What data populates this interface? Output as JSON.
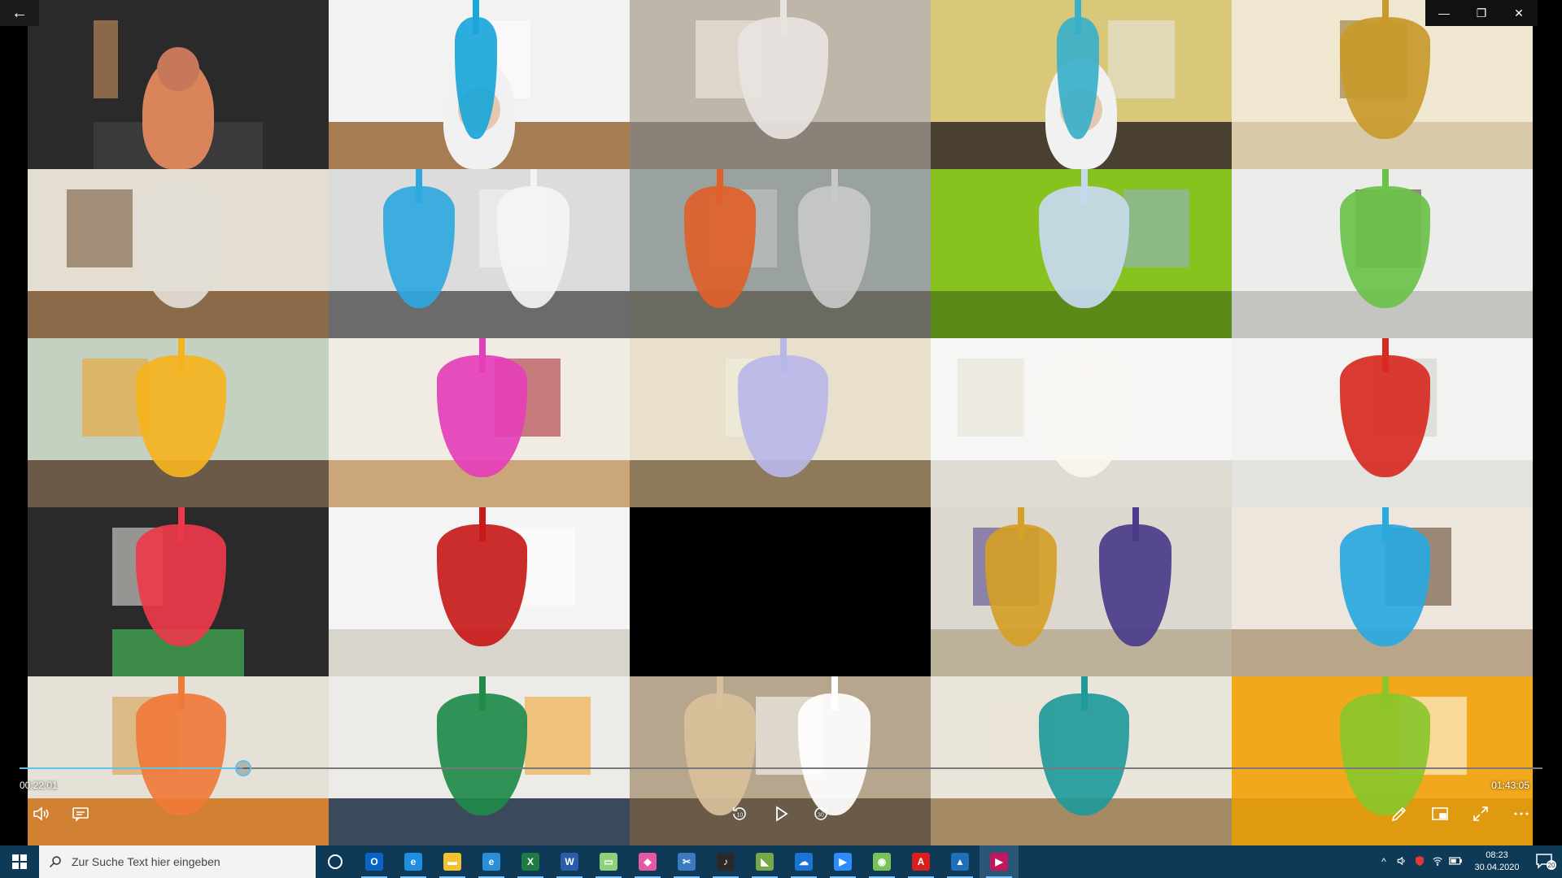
{
  "window": {
    "back_glyph": "←",
    "controls": {
      "minimize": "—",
      "maximize": "❐",
      "close": "✕"
    }
  },
  "player": {
    "current_time": "00:22:01",
    "total_time": "01:43:05",
    "progress_fraction": 0.147,
    "accent": "#5ec3ea",
    "buttons": {
      "volume": "volume-icon",
      "captions": "captions-icon",
      "rewind": "rewind-10-icon",
      "rewind_label": "10",
      "play": "play-icon",
      "forward": "forward-30-icon",
      "forward_label": "30",
      "edit": "pencil-icon",
      "miniview": "mini-view-icon",
      "fullscreen": "fullscreen-icon",
      "more": "more-icon"
    }
  },
  "tiles": [
    {
      "wall": "#2a2a2a",
      "floor": "#3a3a3a",
      "content": "person-outdoor",
      "silk": "",
      "accent": "#d99b63"
    },
    {
      "wall": "#f2f2f2",
      "floor": "#a67c52",
      "content": "person-indoor",
      "silk": "#1aa6d8",
      "accent": "#ffffff"
    },
    {
      "wall": "#bfb6aa",
      "floor": "#8a8278",
      "content": "silk",
      "silk": "#e8e4e0",
      "accent": "#f4f0e6"
    },
    {
      "wall": "#d9c77a",
      "floor": "#4a4030",
      "content": "person-indoor",
      "silk": "#39b0c9",
      "accent": "#e8e8e8"
    },
    {
      "wall": "#f0e7d0",
      "floor": "#d8c9a8",
      "content": "silk",
      "silk": "#c99a2b",
      "accent": "#8a6a20"
    },
    {
      "wall": "#e4ddd2",
      "floor": "#8b6a4a",
      "content": "silk",
      "silk": "#e2ddd5",
      "accent": "#6b4a2a"
    },
    {
      "wall": "#dcdcdc",
      "floor": "#6b6b6b",
      "content": "two-silks",
      "silk": "#2fa8e0",
      "accent": "#f4f4f4"
    },
    {
      "wall": "#9aa2a0",
      "floor": "#6a6a60",
      "content": "two-silks",
      "silk": "#e0602a",
      "accent": "#c8c8c8"
    },
    {
      "wall": "#88c21f",
      "floor": "#5b8a18",
      "content": "silk",
      "silk": "#c7d9f0",
      "accent": "#8fb3d9"
    },
    {
      "wall": "#ececea",
      "floor": "#c4c4c0",
      "content": "silk",
      "silk": "#6ac24a",
      "accent": "#4a3525"
    },
    {
      "wall": "#c4d1c0",
      "floor": "#6b5a48",
      "content": "silk",
      "silk": "#f5b31f",
      "accent": "#f0a020"
    },
    {
      "wall": "#f0ebe3",
      "floor": "#caa678",
      "content": "silk",
      "silk": "#e43fb8",
      "accent": "#a51f2a"
    },
    {
      "wall": "#e8e0cc",
      "floor": "#8c7a5a",
      "content": "silk",
      "silk": "#b9b6e8",
      "accent": "#f3f0e0"
    },
    {
      "wall": "#f6f6f4",
      "floor": "#dedbd3",
      "content": "silk",
      "silk": "#f8f6f0",
      "accent": "#e6e0d2"
    },
    {
      "wall": "#f2f2f0",
      "floor": "#e2e2de",
      "content": "silk",
      "silk": "#d72b22",
      "accent": "#d0d0cc"
    },
    {
      "wall": "#2a2a2a",
      "floor": "#3b8a48",
      "content": "silk-narrow",
      "silk": "#ec3a4a",
      "accent": "#f0ede6"
    },
    {
      "wall": "#f4f4f4",
      "floor": "#d8d5cc",
      "content": "silk",
      "silk": "#c71a1a",
      "accent": "#ffffff"
    },
    {
      "wall": "#000000",
      "floor": "#000000",
      "content": "empty",
      "silk": "",
      "accent": "#000000"
    },
    {
      "wall": "#dcd8cf",
      "floor": "#bcb29a",
      "content": "two-silks",
      "silk": "#d4a028",
      "accent": "#4a3c8a"
    },
    {
      "wall": "#ece6dc",
      "floor": "#b9a58a",
      "content": "silk",
      "silk": "#2aa8e0",
      "accent": "#5a3b22"
    },
    {
      "wall": "#e6e1d6",
      "floor": "#d08030",
      "content": "silk",
      "silk": "#f07a3a",
      "accent": "#d39a48"
    },
    {
      "wall": "#ecebe8",
      "floor": "#3a4a5a",
      "content": "silk",
      "silk": "#1f8a4a",
      "accent": "#f0a020"
    },
    {
      "wall": "#b7a68e",
      "floor": "#6a5a48",
      "content": "two-silks",
      "silk": "#d8c09a",
      "accent": "#ffffff"
    },
    {
      "wall": "#eae6dc",
      "floor": "#a58a66",
      "content": "silk",
      "silk": "#1f9a9a",
      "accent": "#e8e2d2"
    },
    {
      "wall": "#f2a81c",
      "floor": "#e09a10",
      "content": "silk",
      "silk": "#8ac62a",
      "accent": "#ffffff"
    }
  ],
  "taskbar": {
    "search_placeholder": "Zur Suche Text hier eingeben",
    "apps": [
      {
        "name": "task-view",
        "glyph": "○",
        "color": "transparent"
      },
      {
        "name": "outlook",
        "glyph": "O",
        "color": "#0a64c8"
      },
      {
        "name": "internet-explorer",
        "glyph": "e",
        "color": "#1f8ee0"
      },
      {
        "name": "file-explorer",
        "glyph": "▬",
        "color": "#f2c230"
      },
      {
        "name": "edge",
        "glyph": "e",
        "color": "#2a8fd9"
      },
      {
        "name": "excel",
        "glyph": "X",
        "color": "#1f7a44"
      },
      {
        "name": "word",
        "glyph": "W",
        "color": "#2b5caa"
      },
      {
        "name": "notes",
        "glyph": "▭",
        "color": "#8fd07a"
      },
      {
        "name": "paint-3d",
        "glyph": "◆",
        "color": "#e35aa3"
      },
      {
        "name": "snipping",
        "glyph": "✂",
        "color": "#3a7abf"
      },
      {
        "name": "chart-app",
        "glyph": "♪",
        "color": "#2a2a2a"
      },
      {
        "name": "maps",
        "glyph": "◣",
        "color": "#76a845"
      },
      {
        "name": "onedrive",
        "glyph": "☁",
        "color": "#1a74d4"
      },
      {
        "name": "zoom",
        "glyph": "▶",
        "color": "#2d8cff"
      },
      {
        "name": "android",
        "glyph": "◉",
        "color": "#78c257"
      },
      {
        "name": "acrobat",
        "glyph": "A",
        "color": "#d81e1e"
      },
      {
        "name": "photos",
        "glyph": "▲",
        "color": "#1f6fb8"
      },
      {
        "name": "movies-tv",
        "glyph": "▶",
        "color": "#c2185b"
      }
    ],
    "tray": {
      "chevron": "^",
      "volume": "🔊",
      "network": "≋",
      "time": "08:23",
      "date": "30.04.2020",
      "notifications": "20"
    }
  }
}
